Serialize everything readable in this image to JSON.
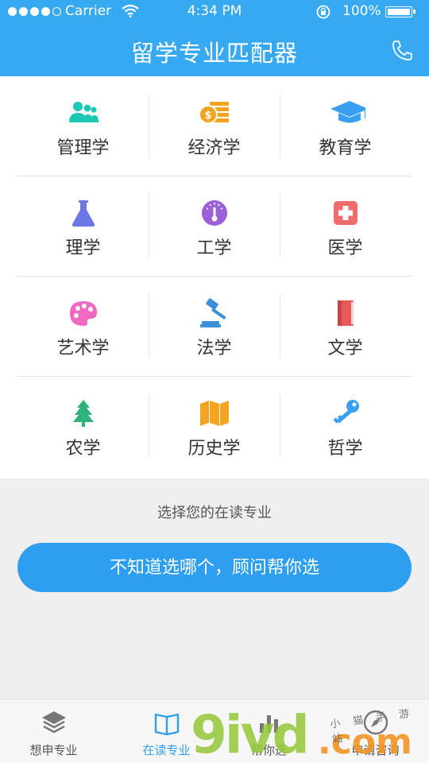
{
  "status_bar": {
    "carrier": "Carrier",
    "time": "4:34 PM",
    "battery": "100%"
  },
  "header": {
    "title": "留学专业匹配器"
  },
  "majors": [
    {
      "label": "管理学",
      "icon": "people-icon",
      "color": "#1ec6b4"
    },
    {
      "label": "经济学",
      "icon": "coins-icon",
      "color": "#f3a521"
    },
    {
      "label": "教育学",
      "icon": "graduation-cap-icon",
      "color": "#3a9ff0"
    },
    {
      "label": "理学",
      "icon": "flask-icon",
      "color": "#6b77e6"
    },
    {
      "label": "工学",
      "icon": "gauge-icon",
      "color": "#9a61d8"
    },
    {
      "label": "医学",
      "icon": "medical-cross-icon",
      "color": "#ee6c6c"
    },
    {
      "label": "艺术学",
      "icon": "palette-icon",
      "color": "#ee6ac1"
    },
    {
      "label": "法学",
      "icon": "gavel-icon",
      "color": "#3a8fd8"
    },
    {
      "label": "文学",
      "icon": "book-icon",
      "color": "#e85a5a"
    },
    {
      "label": "农学",
      "icon": "tree-icon",
      "color": "#2fb37a"
    },
    {
      "label": "历史学",
      "icon": "map-icon",
      "color": "#f3a521"
    },
    {
      "label": "哲学",
      "icon": "key-icon",
      "color": "#3a9ff0"
    }
  ],
  "hint": "选择您的在读专业",
  "advisor_button": "不知道选哪个，顾问帮你选",
  "tabs": [
    {
      "label": "想申专业",
      "icon": "layers-icon",
      "active": false
    },
    {
      "label": "在读专业",
      "icon": "open-book-icon",
      "active": true
    },
    {
      "label": "帮你选",
      "icon": "bar-chart-icon",
      "active": false
    },
    {
      "label": "申请咨询",
      "icon": "compass-icon",
      "active": false
    }
  ],
  "watermark": {
    "main": "9ivd",
    "suffix": ".com",
    "sub": "小 猫 手 游 站"
  },
  "colors": {
    "accent": "#37a9f0",
    "button": "#2e9ff0",
    "background": "#efefef"
  }
}
